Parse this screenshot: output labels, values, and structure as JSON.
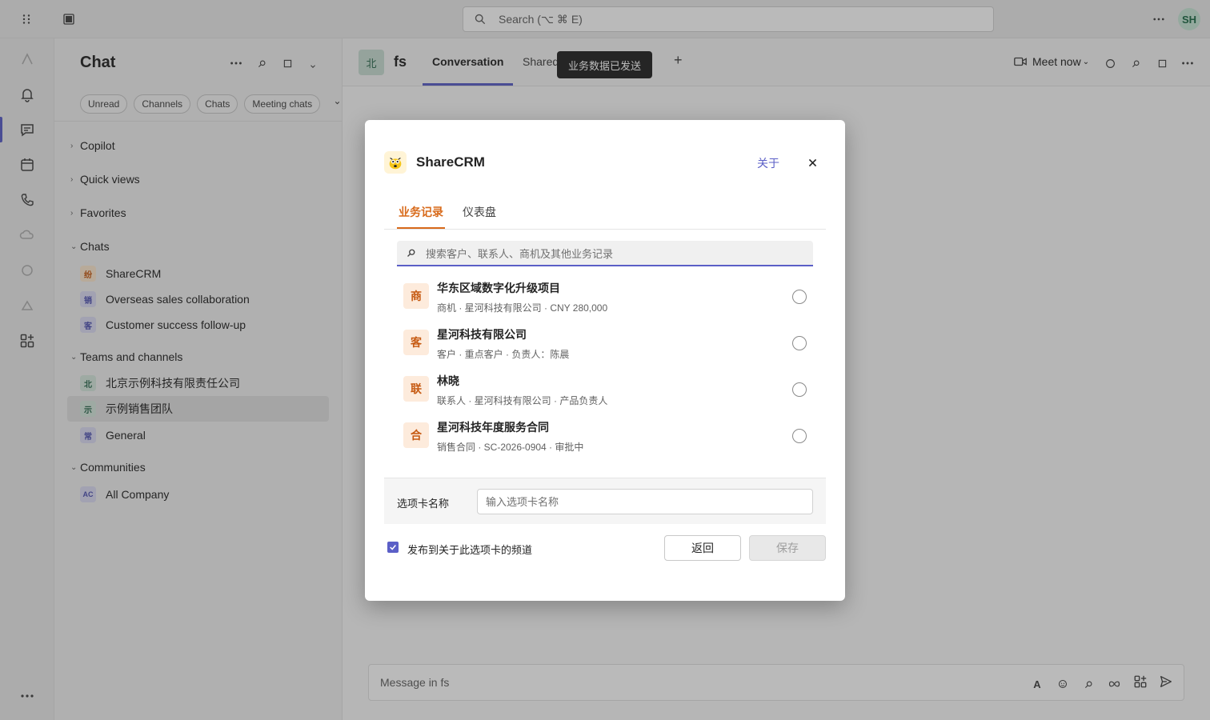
{
  "topbar": {
    "search_placeholder": "Search (⌥ ⌘ E)",
    "avatar_initials": "SH"
  },
  "chat_panel": {
    "title": "Chat",
    "filters": [
      "Unread",
      "Channels",
      "Chats",
      "Meeting chats"
    ],
    "sections": {
      "copilot": "Copilot",
      "quick_views": "Quick views",
      "favorites": "Favorites",
      "chats": "Chats",
      "teams": "Teams and channels",
      "communities": "Communities"
    },
    "chats": [
      {
        "badge": "纷",
        "label": "ShareCRM"
      },
      {
        "badge": "销",
        "label": "Overseas sales collaboration"
      },
      {
        "badge": "客",
        "label": "Customer success follow-up"
      }
    ],
    "teams": [
      {
        "badge": "北",
        "label": "北京示例科技有限责任公司"
      },
      {
        "badge": "示",
        "label": "示例销售团队"
      },
      {
        "badge": "常",
        "label": "General"
      }
    ],
    "communities": [
      {
        "badge": "AC",
        "label": "All Company"
      }
    ]
  },
  "main": {
    "channel_avatar": "北",
    "channel_name": "fs",
    "tabs": [
      "Conversation",
      "Shared"
    ],
    "tooltip": "业务数据已发送",
    "meet_label": "Meet now",
    "composer_placeholder": "Message in fs"
  },
  "dialog": {
    "title": "ShareCRM",
    "about": "关于",
    "tabs": [
      "业务记录",
      "仪表盘"
    ],
    "search_placeholder": "搜索客户、联系人、商机及其他业务记录",
    "records": [
      {
        "badge": "商",
        "title": "华东区域数字化升级项目",
        "subtitle": "商机 · 星河科技有限公司 · CNY 280,000"
      },
      {
        "badge": "客",
        "title": "星河科技有限公司",
        "subtitle": "客户 · 重点客户 · 负责人：陈晨"
      },
      {
        "badge": "联",
        "title": "林晓",
        "subtitle": "联系人 · 星河科技有限公司 · 产品负责人"
      },
      {
        "badge": "合",
        "title": "星河科技年度服务合同",
        "subtitle": "销售合同 · SC-2026-0904 · 审批中"
      }
    ],
    "tab_name_label": "选项卡名称",
    "tab_name_placeholder": "输入选项卡名称",
    "publish_label": "发布到关于此选项卡的频道",
    "back_label": "返回",
    "save_label": "保存"
  },
  "colors": {
    "accent": "#5b5fc7",
    "crm_orange": "#d86a1a"
  }
}
